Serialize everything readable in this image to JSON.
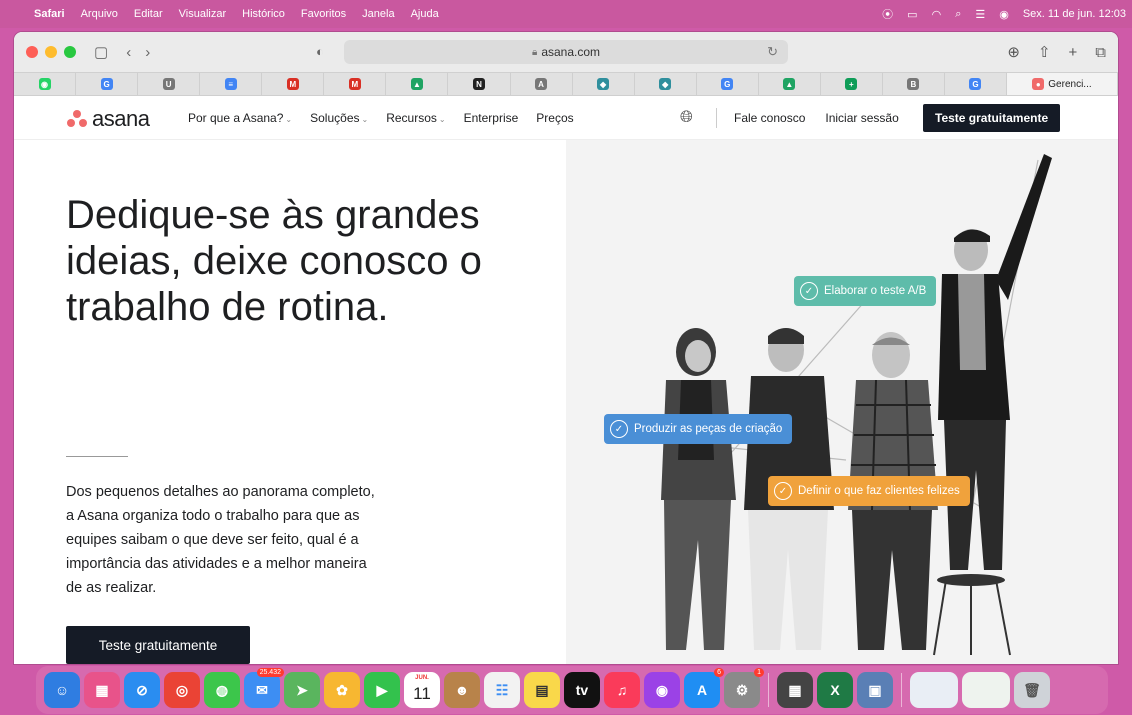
{
  "menubar": {
    "app": "Safari",
    "menus": [
      "Arquivo",
      "Editar",
      "Visualizar",
      "Histórico",
      "Favoritos",
      "Janela",
      "Ajuda"
    ],
    "datetime": "Sex. 11 de jun. 12:03"
  },
  "browser": {
    "url": "asana.com",
    "favorites": [
      {
        "icon": "whatsapp-icon",
        "glyph": "◉",
        "color": "#25d366"
      },
      {
        "icon": "google-icon",
        "glyph": "G",
        "color": "#4285f4"
      },
      {
        "icon": "app-u-icon",
        "glyph": "U",
        "color": "#777777"
      },
      {
        "icon": "docs-icon",
        "glyph": "≡",
        "color": "#4285f4"
      },
      {
        "icon": "gmail-icon",
        "glyph": "M",
        "color": "#d93025"
      },
      {
        "icon": "gmail-icon-2",
        "glyph": "M",
        "color": "#d93025"
      },
      {
        "icon": "drive-icon",
        "glyph": "▲",
        "color": "#1fa463"
      },
      {
        "icon": "notion-icon",
        "glyph": "N",
        "color": "#222222"
      },
      {
        "icon": "app-a-icon",
        "glyph": "A",
        "color": "#777777"
      },
      {
        "icon": "teams-icon",
        "glyph": "◆",
        "color": "#2f8f9d"
      },
      {
        "icon": "teams-icon-2",
        "glyph": "◆",
        "color": "#2f8f9d"
      },
      {
        "icon": "google-icon-2",
        "glyph": "G",
        "color": "#4285f4"
      },
      {
        "icon": "drive-icon-2",
        "glyph": "▲",
        "color": "#1fa463"
      },
      {
        "icon": "sheets-plus-icon",
        "glyph": "+",
        "color": "#0f9d58"
      },
      {
        "icon": "app-b-icon",
        "glyph": "B",
        "color": "#777777"
      },
      {
        "icon": "google-icon-3",
        "glyph": "G",
        "color": "#4285f4"
      }
    ],
    "active_tab": "Gerenci..."
  },
  "nav": {
    "logo": "asana",
    "links": [
      {
        "label": "Por que a Asana?",
        "dropdown": true
      },
      {
        "label": "Soluções",
        "dropdown": true
      },
      {
        "label": "Recursos",
        "dropdown": true
      },
      {
        "label": "Enterprise",
        "dropdown": false
      },
      {
        "label": "Preços",
        "dropdown": false
      }
    ],
    "contact": "Fale conosco",
    "login": "Iniciar sessão",
    "cta": "Teste gratuitamente"
  },
  "hero": {
    "headline": "Dedique-se às grandes ideias, deixe conosco o trabalho de rotina.",
    "description": "Dos pequenos detalhes ao panorama completo, a Asana organiza todo o trabalho para que as equipes saibam o que deve ser feito, qual é a importância das atividades e a melhor maneira de as realizar.",
    "cta": "Teste gratuitamente",
    "tags": {
      "green": "Elaborar o teste A/B",
      "blue": "Produzir as peças de criação",
      "orange": "Definir o que faz clientes felizes"
    }
  },
  "dock": {
    "mail_badge": "25.432",
    "calendar_month": "JUN.",
    "calendar_day": "11",
    "appstore_badge": "6",
    "prefs_badge": "1"
  }
}
